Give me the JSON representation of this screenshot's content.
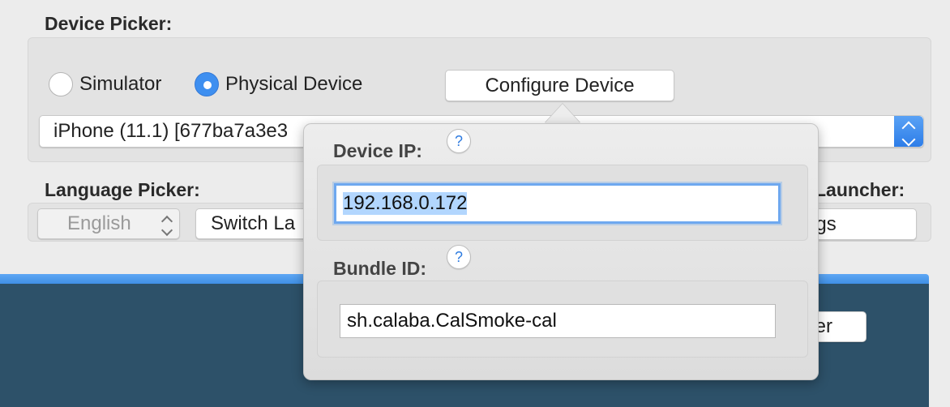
{
  "device_picker": {
    "title": "Device Picker:",
    "radio_simulator": "Simulator",
    "radio_physical": "Physical Device",
    "selected_radio": "Physical Device",
    "configure_button": "Configure Device",
    "device_select_value": "iPhone (11.1) [677ba7a3e3"
  },
  "language_picker": {
    "title": "Language Picker:",
    "select_value": "English",
    "switch_button": "Switch La"
  },
  "launcher": {
    "title": "Launcher:",
    "button_fragment": "ngs"
  },
  "dark_area": {
    "button_fragment": "fer"
  },
  "popover": {
    "device_ip_label": "Device IP:",
    "device_ip_value": "192.168.0.172",
    "bundle_id_label": "Bundle ID:",
    "bundle_id_value": "sh.calaba.CalSmoke-cal",
    "help_glyph": "?"
  },
  "colors": {
    "accent": "#3e8ff0",
    "dark_panel": "#2d5169",
    "selection": "#b2d6fe"
  }
}
